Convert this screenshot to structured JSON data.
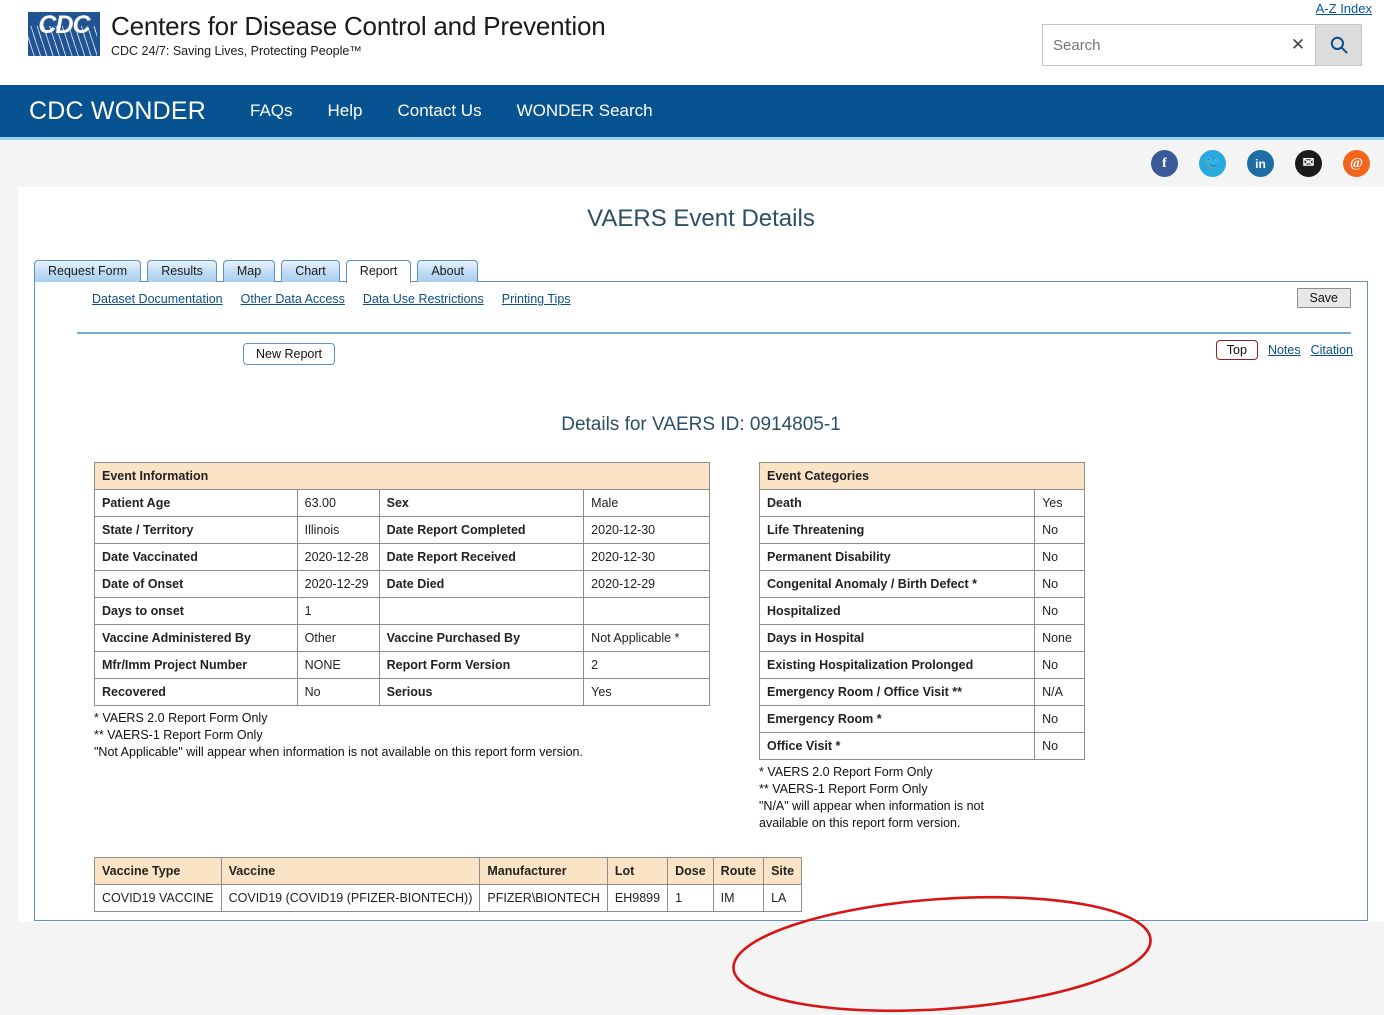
{
  "header": {
    "az_index": "A-Z Index",
    "agency_title": "Centers for Disease Control and Prevention",
    "agency_tagline": "CDC 24/7: Saving Lives, Protecting People™",
    "logo_text": "CDC",
    "search": {
      "placeholder": "Search",
      "value": "",
      "clear_glyph": "✕",
      "submit_icon": "search-icon"
    }
  },
  "nav": {
    "brand": "CDC WONDER",
    "links": [
      {
        "label": "FAQs"
      },
      {
        "label": "Help"
      },
      {
        "label": "Contact Us"
      },
      {
        "label": "WONDER Search"
      }
    ]
  },
  "social": [
    {
      "name": "facebook",
      "glyph": "f",
      "color": "#3b5998"
    },
    {
      "name": "twitter",
      "glyph": "🐦",
      "color": "#2aa9e0"
    },
    {
      "name": "linkedin",
      "glyph": "in",
      "color": "#1c6ea4"
    },
    {
      "name": "email",
      "glyph": "✉",
      "color": "#1b1b1b"
    },
    {
      "name": "syndicate",
      "glyph": "@",
      "color": "#f2631c"
    }
  ],
  "page": {
    "title": "VAERS Event Details",
    "details_heading": "Details for VAERS ID: 0914805-1"
  },
  "tabs": [
    {
      "label": "Request Form",
      "active": false
    },
    {
      "label": "Results",
      "active": false
    },
    {
      "label": "Map",
      "active": false
    },
    {
      "label": "Chart",
      "active": false
    },
    {
      "label": "Report",
      "active": true
    },
    {
      "label": "About",
      "active": false
    }
  ],
  "doc_links": [
    {
      "label": "Dataset Documentation"
    },
    {
      "label": "Other Data Access"
    },
    {
      "label": "Data Use Restrictions"
    },
    {
      "label": "Printing Tips"
    }
  ],
  "buttons": {
    "save": "Save",
    "new_report": "New Report",
    "top": "Top"
  },
  "utility_links": [
    {
      "label": "Notes"
    },
    {
      "label": "Citation"
    }
  ],
  "event_information": {
    "header": "Event Information",
    "rows": [
      {
        "label1": "Patient Age",
        "value1": "63.00",
        "label2": "Sex",
        "value2": "Male"
      },
      {
        "label1": "State / Territory",
        "value1": "Illinois",
        "label2": "Date Report Completed",
        "value2": "2020-12-30"
      },
      {
        "label1": "Date Vaccinated",
        "value1": "2020-12-28",
        "label2": "Date Report Received",
        "value2": "2020-12-30"
      },
      {
        "label1": "Date of Onset",
        "value1": "2020-12-29",
        "label2": "Date Died",
        "value2": "2020-12-29"
      },
      {
        "label1": "Days to onset",
        "value1": "1",
        "label2": "",
        "value2": ""
      },
      {
        "label1": "Vaccine Administered By",
        "value1": "Other",
        "label2": "Vaccine Purchased By",
        "value2": "Not Applicable *"
      },
      {
        "label1": "Mfr/Imm Project Number",
        "value1": "NONE",
        "label2": "Report Form Version",
        "value2": "2"
      },
      {
        "label1": "Recovered",
        "value1": "No",
        "label2": "Serious",
        "value2": "Yes"
      }
    ],
    "footnote": "* VAERS 2.0 Report Form Only\n** VAERS-1 Report Form Only\n\"Not Applicable\" will appear when information is not available on this report form version."
  },
  "event_categories": {
    "header": "Event Categories",
    "rows": [
      {
        "label": "Death",
        "value": "Yes",
        "indent": false
      },
      {
        "label": "Life Threatening",
        "value": "No",
        "indent": false
      },
      {
        "label": "Permanent Disability",
        "value": "No",
        "indent": false
      },
      {
        "label": "Congenital Anomaly / Birth Defect *",
        "value": "No",
        "indent": false
      },
      {
        "label": "Hospitalized",
        "value": "No",
        "indent": false
      },
      {
        "label": "Days in Hospital",
        "value": "None",
        "indent": true
      },
      {
        "label": "Existing Hospitalization Prolonged",
        "value": "No",
        "indent": false
      },
      {
        "label": "Emergency Room / Office Visit **",
        "value": "N/A",
        "indent": false
      },
      {
        "label": "Emergency Room *",
        "value": "No",
        "indent": false
      },
      {
        "label": "Office Visit *",
        "value": "No",
        "indent": false
      }
    ],
    "footnote": "* VAERS 2.0 Report Form Only\n** VAERS-1 Report Form Only\n\"N/A\" will appear when information is not\navailable on this report form version."
  },
  "vaccine_table": {
    "columns": [
      "Vaccine Type",
      "Vaccine",
      "Manufacturer",
      "Lot",
      "Dose",
      "Route",
      "Site"
    ],
    "rows": [
      [
        "COVID19 VACCINE",
        "COVID19 (COVID19 (PFIZER-BIONTECH))",
        "PFIZER\\BIONTECH",
        "EH9899",
        "1",
        "IM",
        "LA"
      ]
    ]
  },
  "annotation": {
    "type": "ellipse-highlight",
    "color": "#d81414",
    "target": "Event Categories table: Death / Life Threatening rows"
  },
  "colors": {
    "nav_blue": "#075290",
    "table_header": "#fbe3c5",
    "link_blue": "#0b4f8a",
    "heading_teal": "#2b5066",
    "annotation_red": "#d81414"
  }
}
